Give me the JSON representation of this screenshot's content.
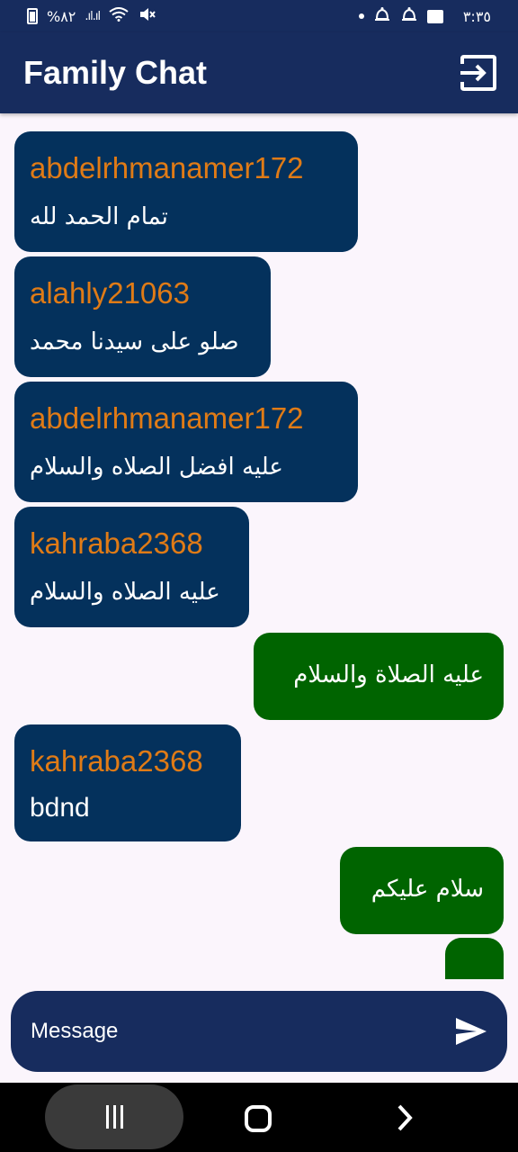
{
  "status_bar": {
    "battery": "%٨٢",
    "time": "٣:٣٥"
  },
  "app_bar": {
    "title": "Family Chat",
    "logout_icon": "logout-icon"
  },
  "messages": [
    {
      "direction": "incoming",
      "sender": "abdelrhmanamer172",
      "text": "تمام الحمد لله"
    },
    {
      "direction": "incoming",
      "sender": "alahly21063",
      "text": "صلو على سيدنا محمد"
    },
    {
      "direction": "incoming",
      "sender": "abdelrhmanamer172",
      "text": "عليه افضل الصلاه والسلام"
    },
    {
      "direction": "incoming",
      "sender": "kahraba2368",
      "text": "عليه الصلاه والسلام"
    },
    {
      "direction": "outgoing",
      "text": "عليه الصلاة والسلام"
    },
    {
      "direction": "incoming",
      "sender": "kahraba2368",
      "text": "bdnd"
    },
    {
      "direction": "outgoing",
      "text": "سلام عليكم"
    },
    {
      "direction": "outgoing",
      "text": ""
    }
  ],
  "input": {
    "placeholder": "Message",
    "value": "",
    "send_icon": "send-icon"
  },
  "nav": {
    "recents_icon": "recents-icon",
    "home_icon": "home-icon",
    "back_icon": "back-icon"
  },
  "colors": {
    "app_bar": "#172c5e",
    "incoming_bubble": "#04315c",
    "outgoing_bubble": "#006400",
    "sender_name": "#e07b16",
    "background": "#fbf5fc"
  }
}
